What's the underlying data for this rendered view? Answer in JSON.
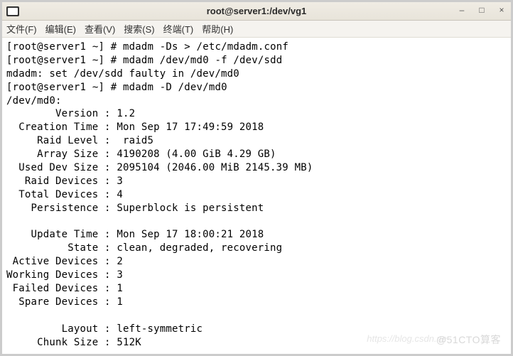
{
  "window": {
    "title": "root@server1:/dev/vg1",
    "minimize": "–",
    "maximize": "□",
    "close": "×"
  },
  "menubar": {
    "file": "文件(F)",
    "edit": "编辑(E)",
    "view": "查看(V)",
    "search": "搜索(S)",
    "terminal": "终端(T)",
    "help": "帮助(H)"
  },
  "prompt_user": "root@server1",
  "prompt_path": "~",
  "prompt_symbol": "#",
  "commands": {
    "cmd1": "mdadm -Ds > /etc/mdadm.conf",
    "cmd2": "mdadm /dev/md0 -f /dev/sdd",
    "cmd2_out": "mdadm: set /dev/sdd faulty in /dev/md0",
    "cmd3": "mdadm -D /dev/md0"
  },
  "device_header": "/dev/md0:",
  "fields": {
    "version_label": "        Version :",
    "version_value": " 1.2",
    "creation_time_label": "  Creation Time :",
    "creation_time_value": " Mon Sep 17 17:49:59 2018",
    "raid_level_label": "     Raid Level :",
    "raid_level_value": "  raid5",
    "array_size_label": "     Array Size :",
    "array_size_value": " 4190208 (4.00 GiB 4.29 GB)",
    "used_dev_label": "  Used Dev Size :",
    "used_dev_value": " 2095104 (2046.00 MiB 2145.39 MB)",
    "raid_devices_label": "   Raid Devices :",
    "raid_devices_value": " 3",
    "total_devices_label": "  Total Devices :",
    "total_devices_value": " 4",
    "persistence_label": "    Persistence :",
    "persistence_value": " Superblock is persistent",
    "update_time_label": "    Update Time :",
    "update_time_value": " Mon Sep 17 18:00:21 2018",
    "state_label": "          State :",
    "state_value": " clean, degraded, recovering",
    "active_dev_label": " Active Devices :",
    "active_dev_value": " 2",
    "working_dev_label": "Working Devices :",
    "working_dev_value": " 3",
    "failed_dev_label": " Failed Devices :",
    "failed_dev_value": " 1",
    "spare_dev_label": "  Spare Devices :",
    "spare_dev_value": " 1",
    "layout_label": "         Layout :",
    "layout_value": " left-symmetric",
    "chunk_label": "     Chunk Size :",
    "chunk_value": " 512K"
  },
  "watermark1": "@51CTO算客",
  "watermark2": "https://blog.csdn.ne"
}
